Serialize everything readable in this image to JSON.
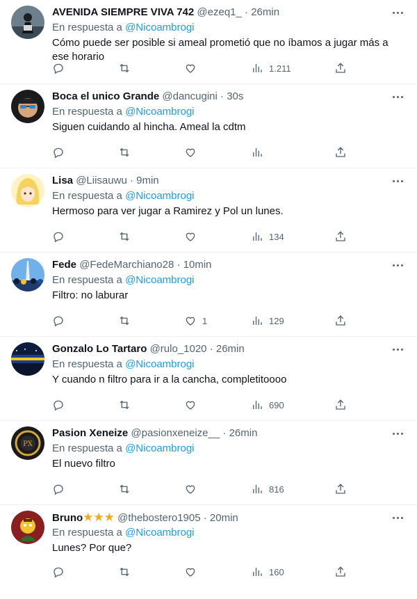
{
  "reply_prefix": "En respuesta a",
  "colors": {
    "accent": "#1d9bf0",
    "muted": "#536471",
    "text": "#0f1419",
    "divider": "#eff3f4"
  },
  "tweets": [
    {
      "name": "AVENIDA SIEMPRE VIVA 742",
      "handle": "@ezeq1_",
      "time": "26min",
      "mention": "@Nicoambrogi",
      "text": "Cómo puede ser posible si ameal prometió que no íbamos a jugar más a ese horario",
      "likes": "",
      "views": "1.211",
      "avatar": "silhouette-person"
    },
    {
      "name": "Boca el unico Grande",
      "handle": "@dancugini",
      "time": "30s",
      "mention": "@Nicoambrogi",
      "text": "Siguen cuidando al hincha. Ameal la cdtm",
      "likes": "",
      "views": "",
      "avatar": "sunglasses-face"
    },
    {
      "name": "Lisa",
      "handle": "@Liisauwu",
      "time": "9min",
      "mention": "@Nicoambrogi",
      "text": "Hermoso para ver jugar a Ramirez y Pol un lunes.",
      "likes": "",
      "views": "134",
      "avatar": "anime-blonde"
    },
    {
      "name": "Fede",
      "handle": "@FedeMarchiano28",
      "time": "10min",
      "mention": "@Nicoambrogi",
      "text": "Filtro: no laburar",
      "likes": "1",
      "views": "129",
      "avatar": "crowd-obelisk"
    },
    {
      "name": "Gonzalo Lo Tartaro",
      "handle": "@rulo_1020",
      "time": "26min",
      "mention": "@Nicoambrogi",
      "text": "Y cuando n filtro para ir a la cancha, completitoooo",
      "likes": "",
      "views": "690",
      "avatar": "stadium-night"
    },
    {
      "name": "Pasion Xeneize",
      "handle": "@pasionxeneize__",
      "time": "26min",
      "mention": "@Nicoambrogi",
      "text": "El nuevo filtro",
      "likes": "",
      "views": "816",
      "avatar": "laurel-emblem"
    },
    {
      "name": "Bruno",
      "name_stars": "★★★",
      "handle": "@thebostero1905",
      "time": "20min",
      "mention": "@Nicoambrogi",
      "text": "Lunes? Por que?",
      "likes": "",
      "views": "160",
      "avatar": "cartoon-character"
    }
  ]
}
